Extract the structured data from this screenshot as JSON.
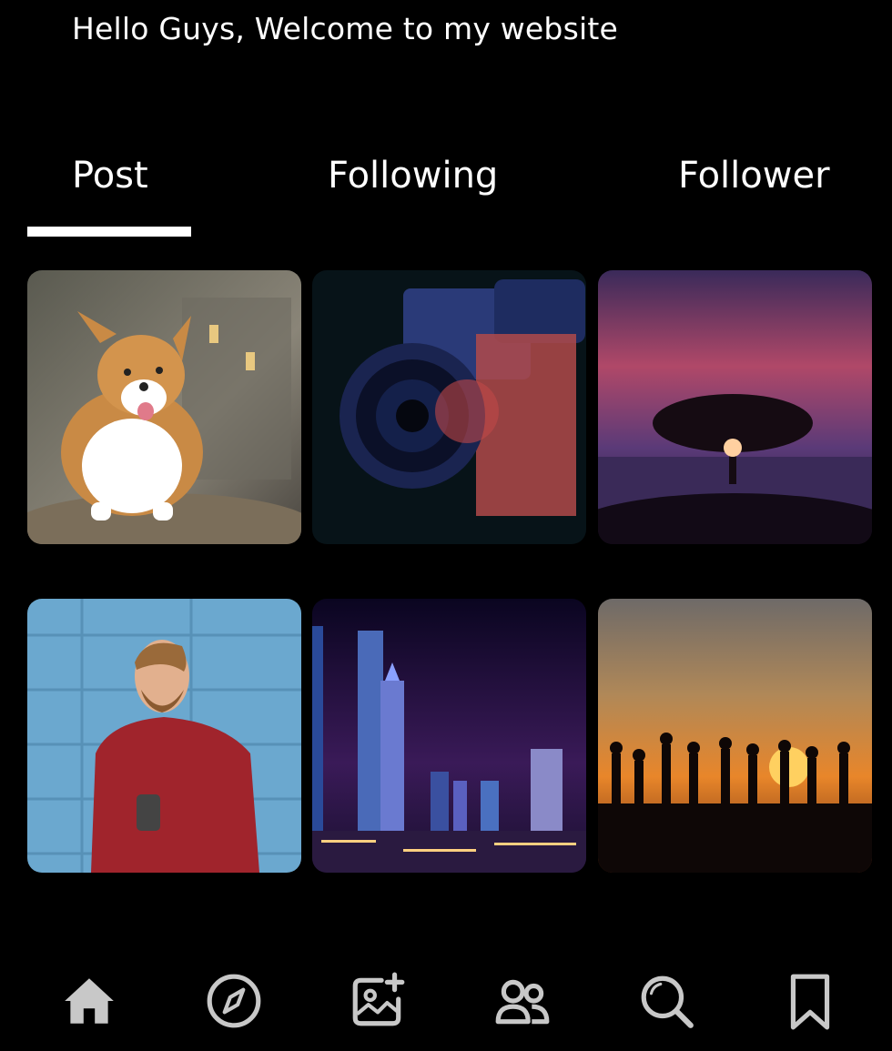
{
  "profile": {
    "bio": "Hello Guys, Welcome to my website"
  },
  "tabs": [
    {
      "label": "Post",
      "active": true
    },
    {
      "label": "Following",
      "active": false
    },
    {
      "label": "Follower",
      "active": false
    }
  ],
  "grid": [
    {
      "subject": "corgi-dog"
    },
    {
      "subject": "video-camera"
    },
    {
      "subject": "tree-sunset"
    },
    {
      "subject": "man-red-sweater"
    },
    {
      "subject": "city-night-skyline"
    },
    {
      "subject": "silhouettes-sunset"
    }
  ],
  "bottom_nav": {
    "icons": [
      "home-icon",
      "compass-icon",
      "add-photo-icon",
      "people-icon",
      "search-icon",
      "bookmark-icon"
    ],
    "icon_color": "#c8c8c8"
  },
  "colors": {
    "background": "#000000",
    "text": "#ffffff",
    "active_indicator": "#ffffff"
  }
}
